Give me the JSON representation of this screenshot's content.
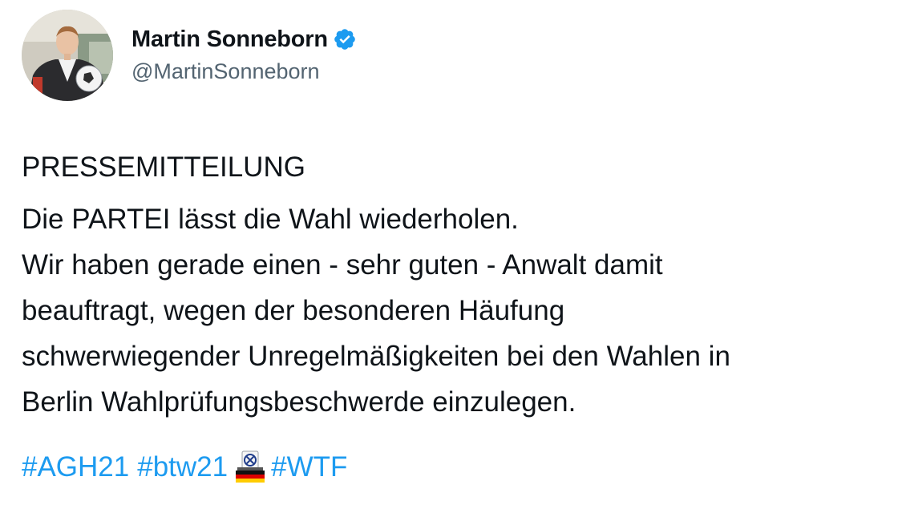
{
  "author": {
    "display_name": "Martin Sonneborn",
    "handle": "@MartinSonneborn",
    "verified": true,
    "verified_color": "#1d9bf0"
  },
  "tweet": {
    "headline": "PRESSEMITTEILUNG",
    "lines": [
      "Die PARTEI lässt die Wahl wiederholen.",
      "Wir haben gerade einen - sehr guten - Anwalt damit",
      "beauftragt, wegen der besonderen Häufung",
      "schwerwiegender Unregelmäßigkeiten bei den Wahlen in",
      "Berlin Wahlprüfungsbeschwerde einzulegen."
    ],
    "hashtags": [
      "#AGH21",
      "#btw21",
      "#WTF"
    ],
    "emoji": "ballot-box-germany-flag-emoji"
  },
  "colors": {
    "text": "#0f1419",
    "secondary_text": "#536471",
    "link": "#1d9bf0"
  }
}
